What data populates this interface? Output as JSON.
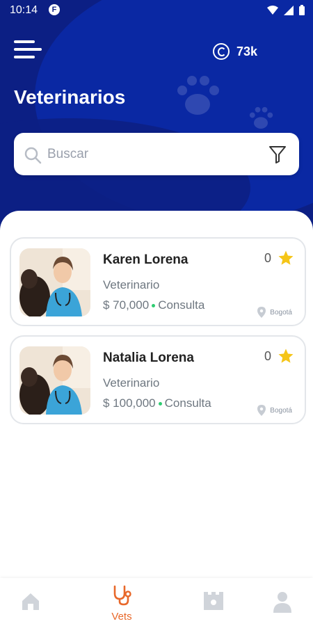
{
  "statusbar": {
    "time": "10:14"
  },
  "header": {
    "title": "Veterinarios",
    "coins": "73k"
  },
  "search": {
    "placeholder": "Buscar"
  },
  "vets": [
    {
      "name": "Karen Lorena",
      "role": "Veterinario",
      "price": "$ 70,000",
      "price_suffix": "Consulta",
      "rating": "0",
      "location": "Bogotá"
    },
    {
      "name": "Natalia Lorena",
      "role": "Veterinario",
      "price": "$ 100,000",
      "price_suffix": "Consulta",
      "rating": "0",
      "location": "Bogotá"
    }
  ],
  "nav": {
    "vets_label": "Vets"
  },
  "colors": {
    "header_bg": "#0c1f84",
    "accent_orange": "#e8682a",
    "star": "#f5c518",
    "online_green": "#2ecc71"
  }
}
